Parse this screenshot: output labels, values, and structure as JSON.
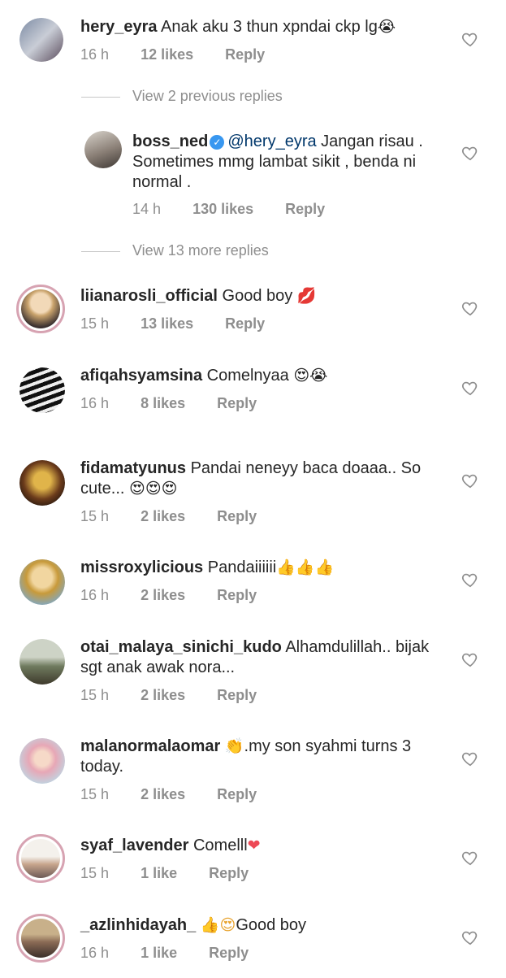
{
  "comments": [
    {
      "username": "hery_eyra",
      "text": "Anak aku 3 thun xpndai ckp lg",
      "emoji": "😭",
      "time": "16 h",
      "likes": "12 likes",
      "reply": "Reply"
    },
    {
      "username": "liianarosli_official",
      "text": "Good boy",
      "emoji": "💋",
      "time": "15 h",
      "likes": "13 likes",
      "reply": "Reply"
    },
    {
      "username": "afiqahsyamsina",
      "text": "Comelnyaa",
      "emoji": "😍😭",
      "time": "16 h",
      "likes": "8 likes",
      "reply": "Reply"
    },
    {
      "username": "fidamatyunus",
      "text": "Pandai neneyy baca doaaa.. So cute...",
      "emoji": "😍😍😍",
      "time": "15 h",
      "likes": "2 likes",
      "reply": "Reply"
    },
    {
      "username": "missroxylicious",
      "text": "Pandaiiiiii",
      "emoji": "👍👍👍",
      "time": "16 h",
      "likes": "2 likes",
      "reply": "Reply"
    },
    {
      "username": "otai_malaya_sinichi_kudo",
      "text": "Alhamdulillah.. bijak sgt anak awak nora...",
      "emoji": "",
      "time": "15 h",
      "likes": "2 likes",
      "reply": "Reply"
    },
    {
      "username": "malanormalaomar",
      "text": ".my son syahmi turns 3 today.",
      "emoji": "👏",
      "time": "15 h",
      "likes": "2 likes",
      "reply": "Reply"
    },
    {
      "username": "syaf_lavender",
      "text": "Comelll",
      "emoji": "❤",
      "time": "15 h",
      "likes": "1 like",
      "reply": "Reply"
    },
    {
      "username": "_azlinhidayah_",
      "text": "Good boy",
      "emoji": "👍😍",
      "time": "16 h",
      "likes": "1 like",
      "reply": "Reply"
    }
  ],
  "reply_thread": {
    "view_previous": "View 2 previous replies",
    "reply": {
      "username": "boss_ned",
      "mention": "@hery_eyra",
      "text": "Jangan risau . Sometimes mmg lambat sikit , benda ni normal .",
      "time": "14 h",
      "likes": "130 likes",
      "reply": "Reply"
    },
    "view_more": "View 13 more replies"
  },
  "colors": {
    "text": "#262626",
    "muted": "#8e8e8e",
    "mention": "#00376b",
    "verified": "#3897f0",
    "heart_red": "#ed4956"
  }
}
